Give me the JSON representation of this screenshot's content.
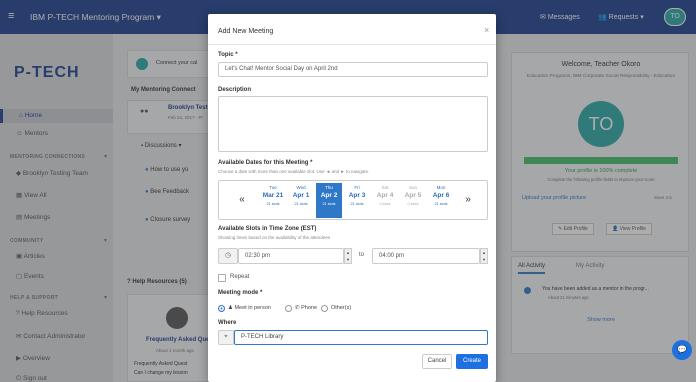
{
  "topbar": {
    "title": "IBM P-TECH Mentoring Program ▾",
    "messages": "Messages",
    "requests": "Requests ▾",
    "avatar_initials": "TO"
  },
  "sidebar": {
    "logo": "P-TECH",
    "items": [
      {
        "label": "Home"
      },
      {
        "label": "Mentors"
      },
      {
        "label": "Brooklyn Testing Team"
      },
      {
        "label": "View All"
      },
      {
        "label": "Meetings"
      },
      {
        "label": "Articles"
      },
      {
        "label": "Events"
      },
      {
        "label": "Help Resources"
      },
      {
        "label": "Contact Administrator"
      },
      {
        "label": "Overview"
      },
      {
        "label": "Sign out"
      }
    ],
    "sections": [
      "MENTORING CONNECTIONS",
      "COMMUNITY",
      "HELP & SUPPORT"
    ]
  },
  "main": {
    "connect_text": "Connect your cal",
    "my_connections": "My Mentoring Connect",
    "connection_name": "Brooklyn Test",
    "connection_date": "Feb 24, 2017 - Pr",
    "discussions": "Discussions ▾",
    "tasks": [
      "How to use yo",
      "Bee Feedback",
      "Closure survey"
    ],
    "help_title": "Help Resources (5)",
    "faq_title": "Frequently Asked Que",
    "faq_meta": "About 1 month ago",
    "faq_body": "Frequently Asked Quest",
    "faq_body2": "Can I change my lesson"
  },
  "right": {
    "welcome": "Welcome, Teacher Okoro",
    "profile_desc": "Education Programs, IBM Corporate Social Responsibility - Education",
    "avatar": "TO",
    "profile_status": "Your profile is 100% complete",
    "profile_hint": "Complete the following profile fields to improve your score",
    "upload": "Upload your profile picture",
    "save": "Save 4.5",
    "edit_profile": "Edit Profile",
    "view_profile": "View Profile",
    "tab_all": "All Activity",
    "tab_my": "My Activity",
    "activity_text": "You have been added as a mentor in the progr...",
    "activity_meta": "About 21 minutes ago",
    "show_more": "Show more"
  },
  "modal": {
    "title": "Add New Meeting",
    "topic_label": "Topic *",
    "topic_value": "Let's Chat! Mentor Social Day on April 2nd",
    "description_label": "Description",
    "dates_label": "Available Dates for this Meeting *",
    "dates_hint": "Choose a date with more than one available slot. Use ◄ and ► to navigate.",
    "days": [
      {
        "weekday": "Tue",
        "date": "Mar 21",
        "slots": "21 slots"
      },
      {
        "weekday": "Wed",
        "date": "Apr 1",
        "slots": "21 slots"
      },
      {
        "weekday": "Thu",
        "date": "Apr 2",
        "slots": "21 slots"
      },
      {
        "weekday": "Fri",
        "date": "Apr 3",
        "slots": "21 slots"
      },
      {
        "weekday": "Sat",
        "date": "Apr 4",
        "slots": "0 slots"
      },
      {
        "weekday": "Sun",
        "date": "Apr 5",
        "slots": "0 slots"
      },
      {
        "weekday": "Mon",
        "date": "Apr 6",
        "slots": "21 slots"
      }
    ],
    "slots_label": "Available Slots in Time Zone (EST)",
    "slots_hint": "Showing times based on the availability of the attendees",
    "time_from": "02:30 pm",
    "time_to": "04:00 pm",
    "to_label": "to",
    "repeat_label": "Repeat",
    "mode_label": "Meeting mode *",
    "mode_options": [
      "Meet in person",
      "Phone",
      "Other(s)"
    ],
    "where_label": "Where",
    "where_value": "P-TECH Library",
    "cancel": "Cancel",
    "create": "Create"
  }
}
